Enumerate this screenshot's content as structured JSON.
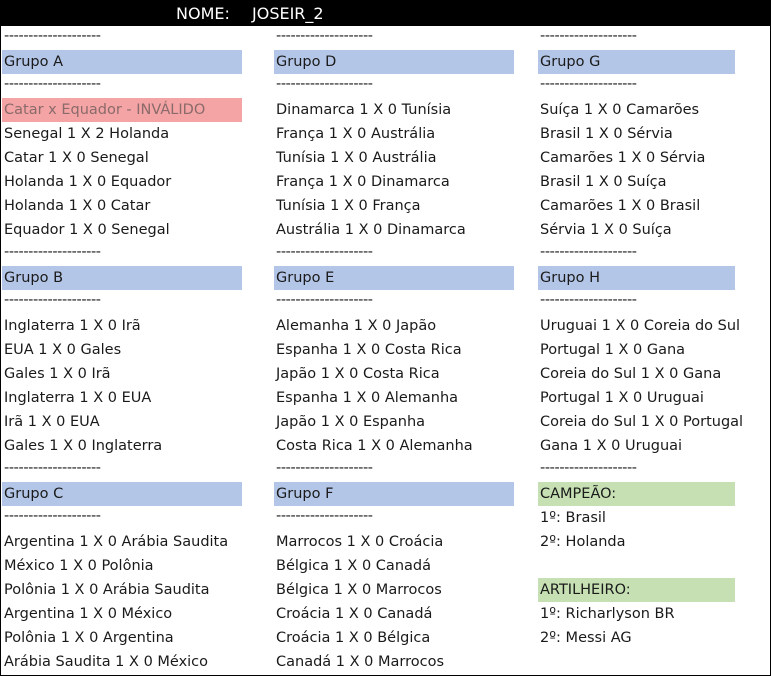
{
  "header": {
    "label": "NOME:",
    "value": "JOSEIR_2"
  },
  "separator": "--------------------",
  "groups": {
    "A": {
      "title": "Grupo A",
      "matches": [
        "Catar x Equador - INVÁLIDO",
        "Senegal 1 X 2 Holanda",
        "Catar 1 X 0 Senegal",
        "Holanda 1 X 0 Equador",
        "Holanda 1 X 0 Catar",
        "Equador 1 X 0 Senegal"
      ]
    },
    "B": {
      "title": "Grupo B",
      "matches": [
        "Inglaterra 1 X 0 Irã",
        "EUA 1 X 0 Gales",
        "Gales 1 X 0 Irã",
        "Inglaterra 1 X 0 EUA",
        "Irã 1 X 0 EUA",
        "Gales 1 X 0 Inglaterra"
      ]
    },
    "C": {
      "title": "Grupo C",
      "matches": [
        "Argentina 1 X 0 Arábia Saudita",
        "México 1 X 0 Polônia",
        "Polônia 1 X 0 Arábia Saudita",
        "Argentina 1 X 0 México",
        "Polônia 1 X 0 Argentina",
        "Arábia Saudita 1 X 0 México"
      ]
    },
    "D": {
      "title": "Grupo D",
      "matches": [
        "Dinamarca 1 X 0 Tunísia",
        "França 1 X 0 Austrália",
        "Tunísia 1 X 0 Austrália",
        "França 1 X 0 Dinamarca",
        "Tunísia 1 X 0 França",
        "Austrália 1 X 0 Dinamarca"
      ]
    },
    "E": {
      "title": "Grupo E",
      "matches": [
        "Alemanha 1 X 0 Japão",
        "Espanha 1 X 0 Costa Rica",
        "Japão 1 X 0 Costa Rica",
        "Espanha 1 X 0 Alemanha",
        "Japão 1 X 0 Espanha",
        "Costa Rica 1 X 0 Alemanha"
      ]
    },
    "F": {
      "title": "Grupo F",
      "matches": [
        "Marrocos 1 X 0 Croácia",
        "Bélgica 1 X 0 Canadá",
        "Bélgica 1 X 0 Marrocos",
        "Croácia 1 X 0 Canadá",
        "Croácia 1 X 0 Bélgica",
        "Canadá 1 X 0 Marrocos"
      ]
    },
    "G": {
      "title": "Grupo G",
      "matches": [
        "Suíça 1 X 0 Camarões",
        "Brasil 1 X 0 Sérvia",
        "Camarões 1 X 0 Sérvia",
        "Brasil 1 X 0 Suíça",
        "Camarões 1 X 0 Brasil",
        "Sérvia 1 X 0 Suíça"
      ]
    },
    "H": {
      "title": "Grupo H",
      "matches": [
        "Uruguai 1 X 0 Coreia do Sul",
        "Portugal 1 X 0 Gana",
        "Coreia do Sul 1 X 0 Gana",
        "Portugal 1 X 0 Uruguai",
        "Coreia do Sul 1 X 0 Portugal",
        "Gana 1 X 0 Uruguai"
      ]
    }
  },
  "campeao": {
    "title": "CAMPEÃO:",
    "first": "1º: Brasil",
    "second": "2º: Holanda"
  },
  "artilheiro": {
    "title": "ARTILHEIRO:",
    "first": "1º: Richarlyson BR",
    "second": "2º: Messi AG"
  },
  "colors": {
    "group_header": "#b4c6e7",
    "highlight_green": "#c6e0b4",
    "invalid": "#f4a4a4"
  }
}
